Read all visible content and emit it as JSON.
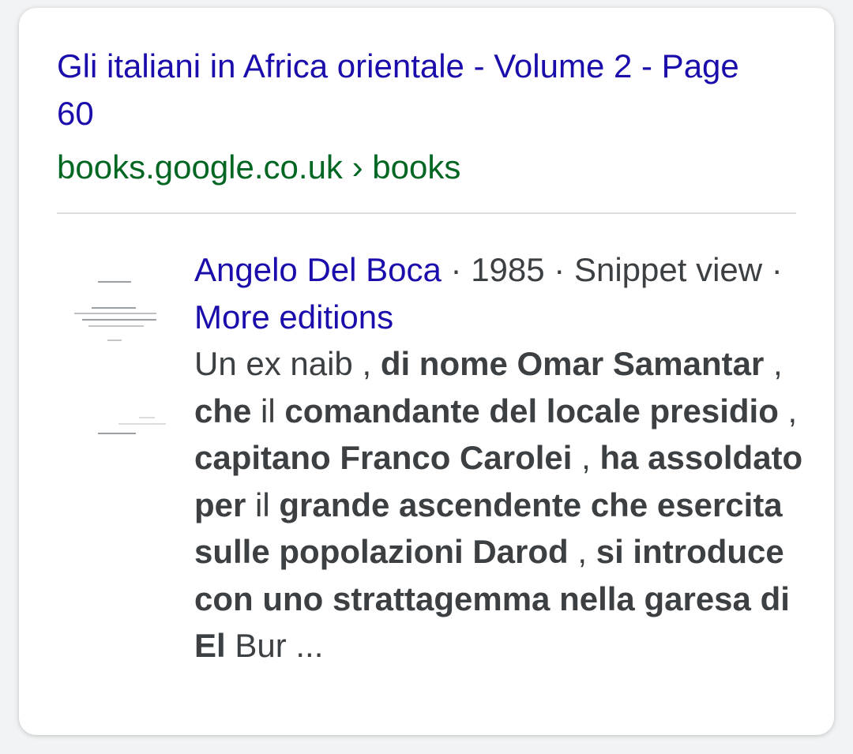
{
  "result": {
    "title": "Gli italiani in Africa orientale - Volume 2 - Page 60",
    "url": "books.google.co.uk › books",
    "book": {
      "author": "Angelo Del Boca",
      "separator": " · ",
      "year": "1985",
      "view_type": "Snippet view",
      "more_editions": "More editions"
    },
    "snippet": [
      {
        "text": "Un ex naib , ",
        "bold": false
      },
      {
        "text": "di nome Omar Samantar",
        "bold": true
      },
      {
        "text": " , ",
        "bold": false
      },
      {
        "text": "che",
        "bold": true
      },
      {
        "text": " il ",
        "bold": false
      },
      {
        "text": "comandante del locale presidio",
        "bold": true
      },
      {
        "text": " , ",
        "bold": false
      },
      {
        "text": "capitano Franco Carolei",
        "bold": true
      },
      {
        "text": " , ",
        "bold": false
      },
      {
        "text": "ha assoldato per",
        "bold": true
      },
      {
        "text": " il ",
        "bold": false
      },
      {
        "text": "grande ascendente che esercita sulle popolazioni Darod",
        "bold": true
      },
      {
        "text": " , ",
        "bold": false
      },
      {
        "text": "si introduce con uno strattagemma nella garesa di El",
        "bold": true
      },
      {
        "text": " Bur ...",
        "bold": false
      }
    ]
  },
  "colors": {
    "link": "#1a0dab",
    "url": "#006621",
    "text": "#3c4043",
    "divider": "#dadce0"
  }
}
